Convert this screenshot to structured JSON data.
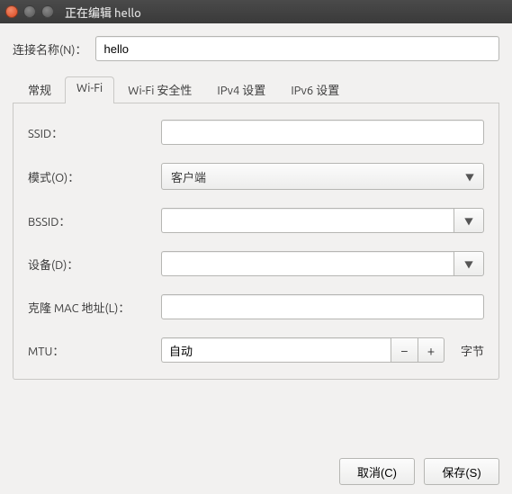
{
  "window": {
    "title": "正在编辑 hello"
  },
  "conn": {
    "label": "连接名称(N)：",
    "value": "hello"
  },
  "tabs": {
    "general": "常规",
    "wifi": "Wi-Fi",
    "security": "Wi-Fi 安全性",
    "ipv4": "IPv4 设置",
    "ipv6": "IPv6 设置"
  },
  "fields": {
    "ssid_label": "SSID：",
    "ssid_value": "",
    "mode_label": "模式(O)：",
    "mode_value": "客户端",
    "bssid_label": "BSSID：",
    "bssid_value": "",
    "device_label": "设备(D)：",
    "device_value": "",
    "clone_label": "克隆 MAC 地址(L)：",
    "clone_value": "",
    "mtu_label": "MTU：",
    "mtu_value": "自动",
    "mtu_unit": "字节"
  },
  "buttons": {
    "cancel": "取消(C)",
    "save": "保存(S)"
  }
}
